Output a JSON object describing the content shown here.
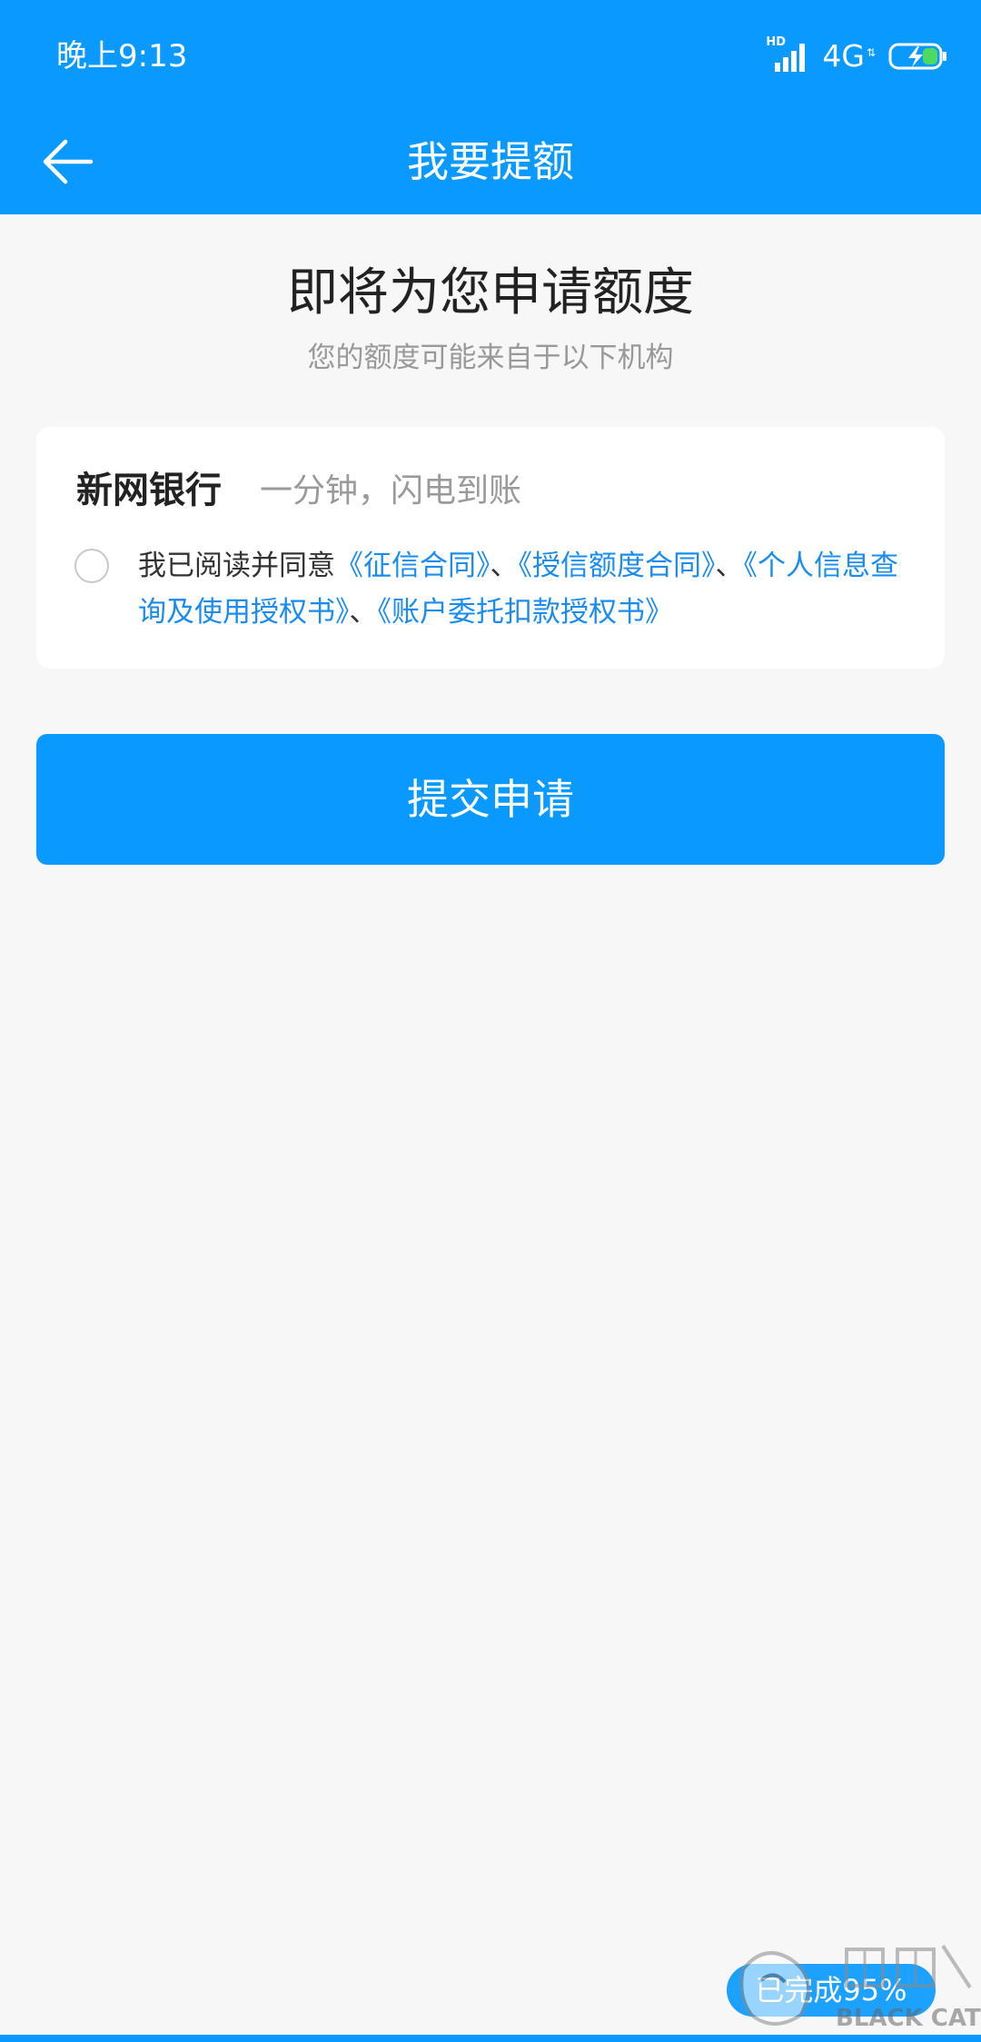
{
  "status_bar": {
    "time": "晚上9:13",
    "hd_label": "HD",
    "network": "4G",
    "network_sub": "⇅"
  },
  "nav": {
    "title": "我要提额"
  },
  "main": {
    "title": "即将为您申请额度",
    "subtitle": "您的额度可能来自于以下机构"
  },
  "card": {
    "bank_name": "新网银行",
    "slogan": "一分钟，闪电到账",
    "agreement": {
      "prefix": "我已阅读并同意",
      "links": [
        "《征信合同》",
        "《授信额度合同》",
        "《个人信息查询及使用授权书》",
        "《账户委托扣款授权书》"
      ],
      "separator": "、"
    }
  },
  "submit_label": "提交申请",
  "progress": {
    "label": "已完成95%",
    "percent": 95
  },
  "watermark": {
    "text": "BLACK CAT"
  },
  "colors": {
    "primary": "#0a9aff",
    "link": "#1a8cf0",
    "background": "#f7f7f7"
  }
}
